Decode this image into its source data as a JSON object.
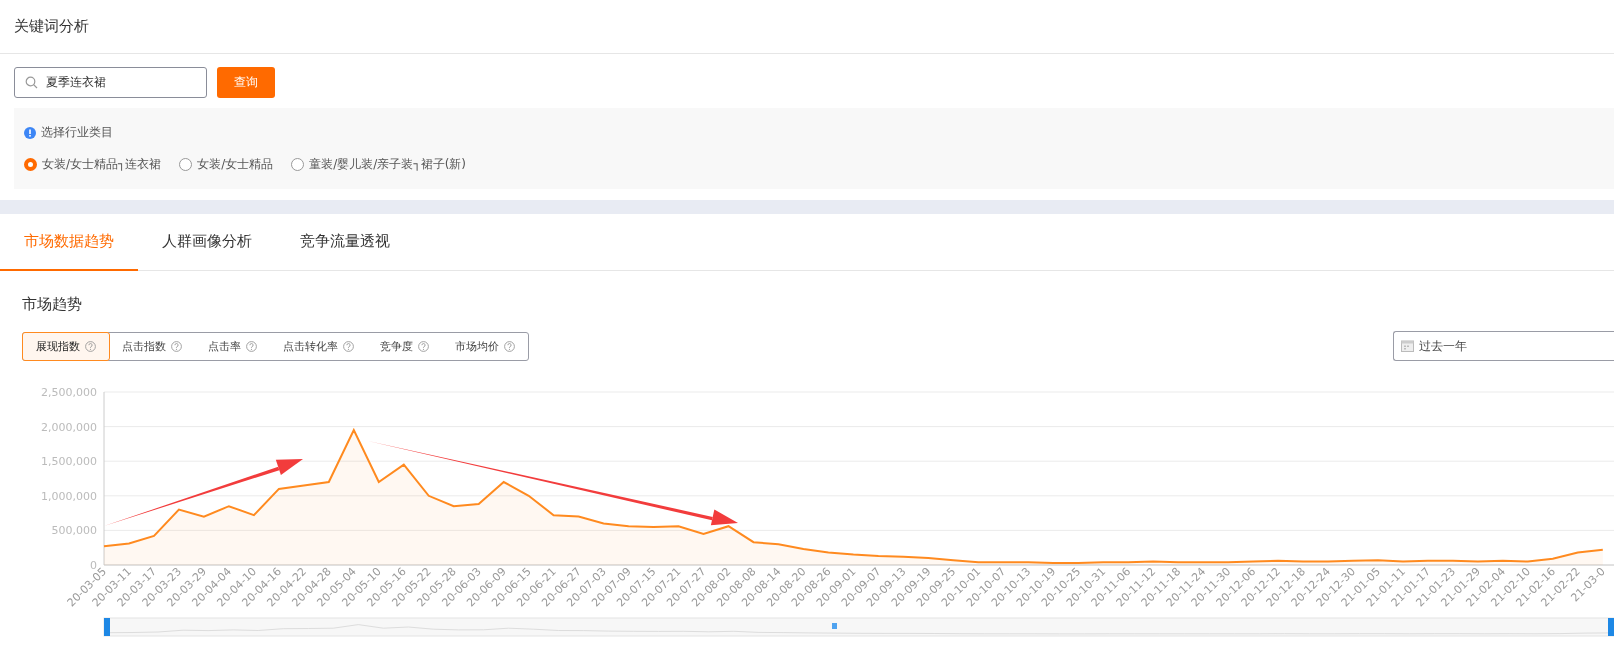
{
  "page_title": "关键词分析",
  "search": {
    "value": "夏季连衣裙",
    "button": "查询"
  },
  "category": {
    "label": "选择行业类目",
    "options": [
      {
        "label": "女装/女士精品┐连衣裙",
        "selected": true
      },
      {
        "label": "女装/女士精品",
        "selected": false
      },
      {
        "label": "童装/婴儿装/亲子装┐裙子(新)",
        "selected": false
      }
    ]
  },
  "tabs": [
    {
      "label": "市场数据趋势",
      "selected": true
    },
    {
      "label": "人群画像分析",
      "selected": false
    },
    {
      "label": "竞争流量透视",
      "selected": false
    }
  ],
  "section_title": "市场趋势",
  "metrics": [
    {
      "label": "展现指数",
      "selected": true
    },
    {
      "label": "点击指数",
      "selected": false
    },
    {
      "label": "点击率",
      "selected": false
    },
    {
      "label": "点击转化率",
      "selected": false
    },
    {
      "label": "竞争度",
      "selected": false
    },
    {
      "label": "市场均价",
      "selected": false
    }
  ],
  "period": {
    "value": "过去一年"
  },
  "chart_data": {
    "type": "area",
    "categories": [
      "20-03-05",
      "20-03-11",
      "20-03-17",
      "20-03-23",
      "20-03-29",
      "20-04-04",
      "20-04-10",
      "20-04-16",
      "20-04-22",
      "20-04-28",
      "20-05-04",
      "20-05-10",
      "20-05-16",
      "20-05-22",
      "20-05-28",
      "20-06-03",
      "20-06-09",
      "20-06-15",
      "20-06-21",
      "20-06-27",
      "20-07-03",
      "20-07-09",
      "20-07-15",
      "20-07-21",
      "20-07-27",
      "20-08-02",
      "20-08-08",
      "20-08-14",
      "20-08-20",
      "20-08-26",
      "20-09-01",
      "20-09-07",
      "20-09-13",
      "20-09-19",
      "20-09-25",
      "20-10-01",
      "20-10-07",
      "20-10-13",
      "20-10-19",
      "20-10-25",
      "20-10-31",
      "20-11-06",
      "20-11-12",
      "20-11-18",
      "20-11-24",
      "20-11-30",
      "20-12-06",
      "20-12-12",
      "20-12-18",
      "20-12-24",
      "20-12-30",
      "21-01-05",
      "21-01-11",
      "21-01-17",
      "21-01-23",
      "21-01-29",
      "21-02-04",
      "21-02-10",
      "21-02-16",
      "21-02-22",
      "21-03-0"
    ],
    "series": [
      {
        "color": "#ff8a1f",
        "values": [
          270000,
          310000,
          420000,
          800000,
          700000,
          850000,
          720000,
          1100000,
          1150000,
          1200000,
          1950000,
          1200000,
          1450000,
          1000000,
          850000,
          880000,
          1200000,
          1000000,
          720000,
          700000,
          600000,
          560000,
          550000,
          560000,
          450000,
          560000,
          330000,
          300000,
          230000,
          180000,
          150000,
          130000,
          120000,
          100000,
          70000,
          40000,
          40000,
          40000,
          30000,
          30000,
          40000,
          40000,
          50000,
          40000,
          40000,
          40000,
          50000,
          60000,
          50000,
          50000,
          60000,
          70000,
          50000,
          60000,
          60000,
          50000,
          60000,
          50000,
          90000,
          180000,
          220000
        ]
      }
    ],
    "grid": true,
    "ylim": [
      0,
      2500000
    ],
    "yticks": [
      {
        "value": 0,
        "label": "0"
      },
      {
        "value": 500000,
        "label": "500,000"
      },
      {
        "value": 1000000,
        "label": "1,000,000"
      },
      {
        "value": 1500000,
        "label": "1,500,000"
      },
      {
        "value": 2000000,
        "label": "2,000,000"
      },
      {
        "value": 2500000,
        "label": "2,500,000"
      }
    ]
  }
}
